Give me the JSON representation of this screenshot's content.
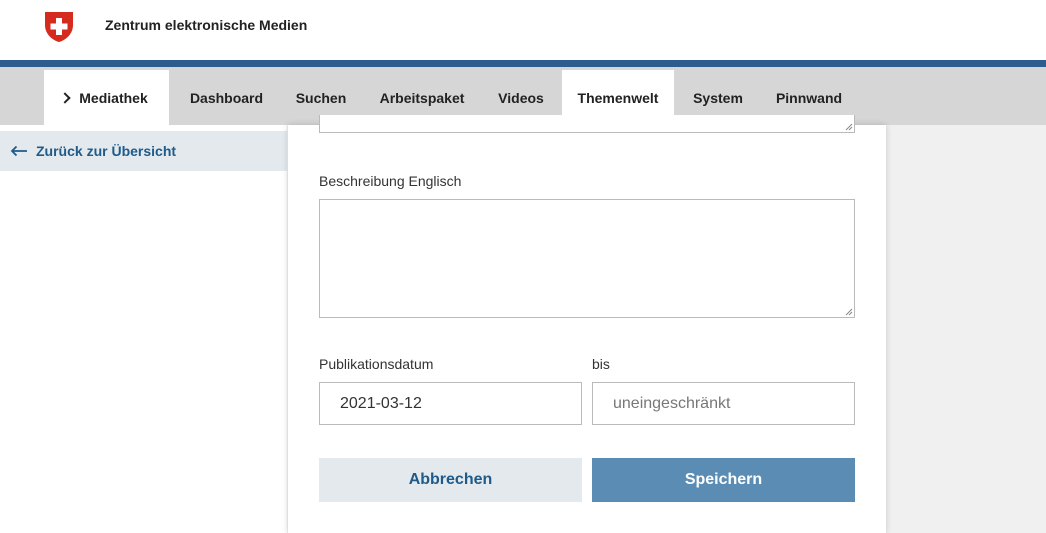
{
  "header": {
    "site_title": "Zentrum elektronische Medien",
    "brand_color": "#d52b1e",
    "bar_color": "#2f5c8f"
  },
  "nav": {
    "items": [
      {
        "label": "Mediathek",
        "active": true
      },
      {
        "label": "Dashboard",
        "active": false
      },
      {
        "label": "Suchen",
        "active": false
      },
      {
        "label": "Arbeitspaket",
        "active": false
      },
      {
        "label": "Videos",
        "active": false
      },
      {
        "label": "Themenwelt",
        "active": true
      },
      {
        "label": "System",
        "active": false
      },
      {
        "label": "Pinnwand",
        "active": false
      }
    ]
  },
  "sidebar": {
    "back_label": "Zurück zur Übersicht",
    "back_icon": "arrow-left-icon"
  },
  "form": {
    "description_en_label": "Beschreibung Englisch",
    "description_en_value": "",
    "publication_date_label": "Publikationsdatum",
    "publication_date_value": "2021-03-12",
    "until_label": "bis",
    "until_placeholder": "uneingeschränkt",
    "cancel_label": "Abbrechen",
    "save_label": "Speichern"
  }
}
